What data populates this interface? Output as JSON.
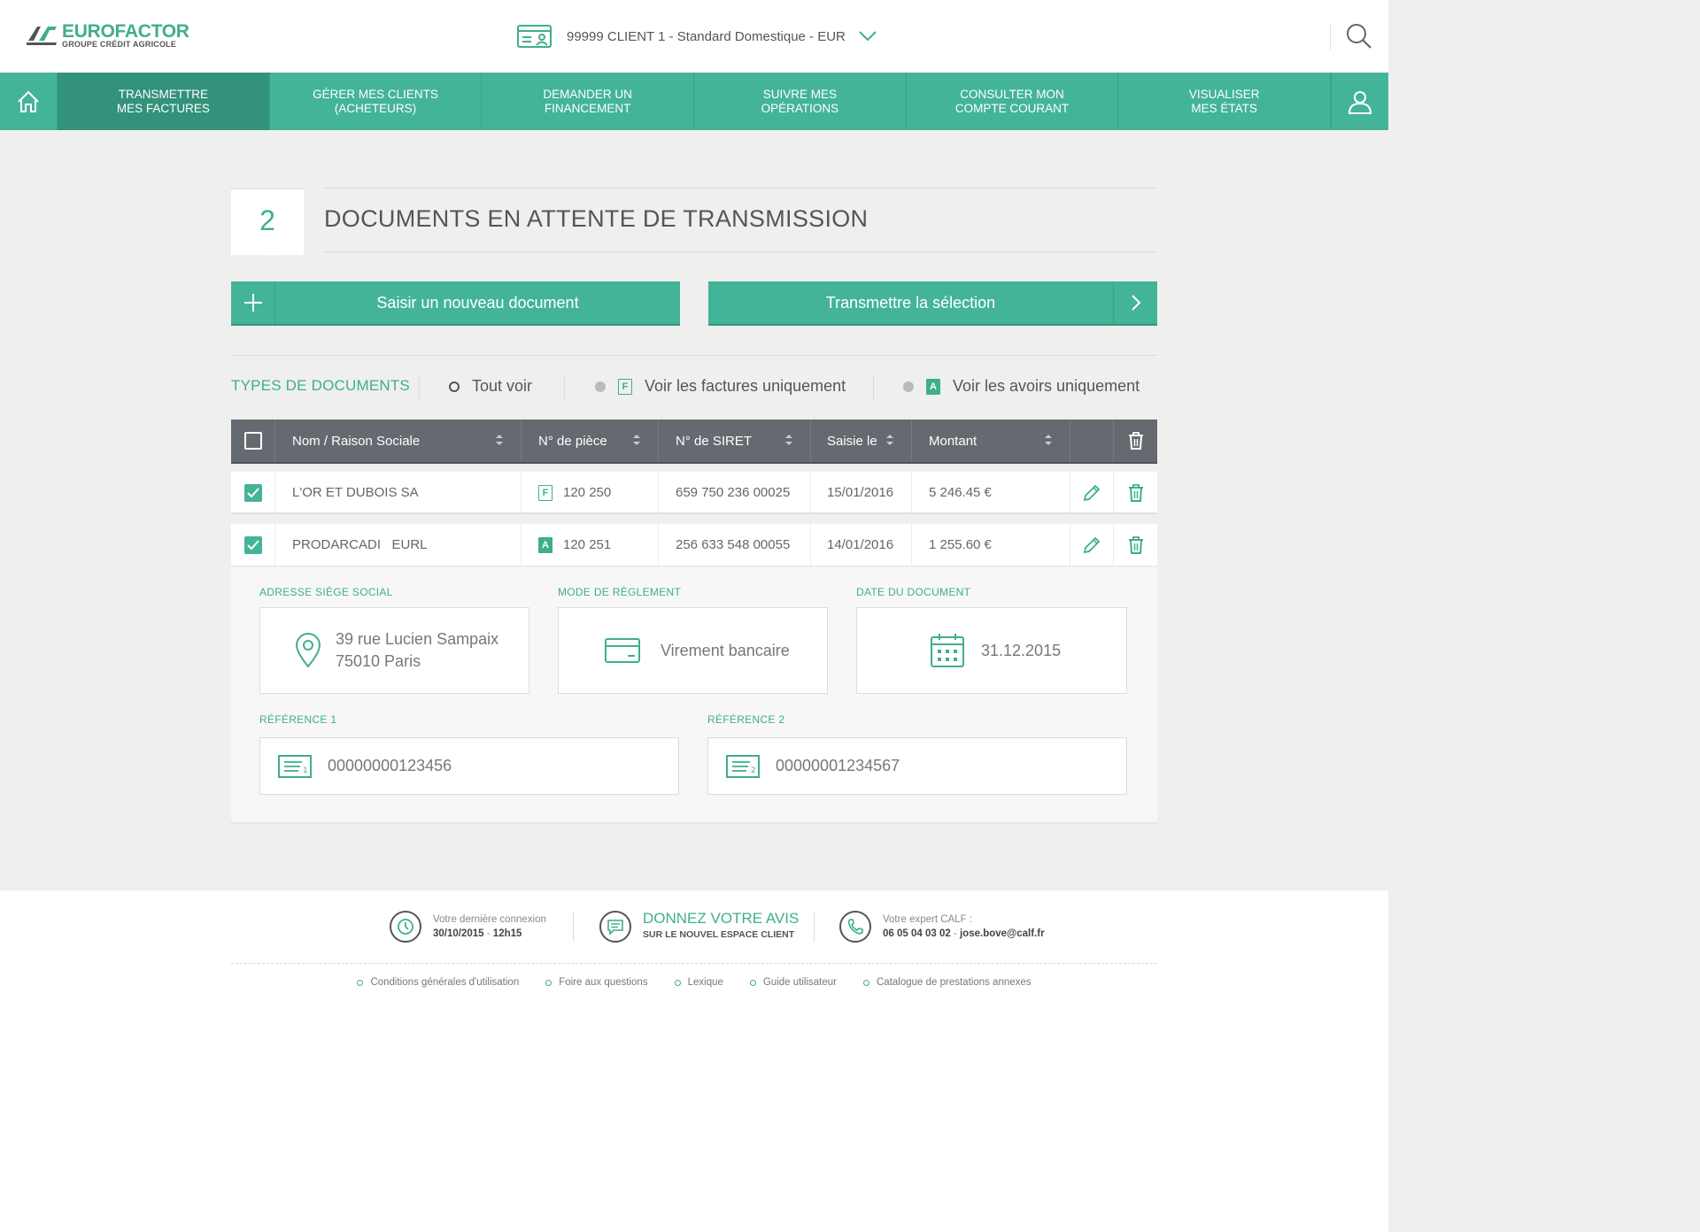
{
  "header": {
    "brand": "EUROFACTOR",
    "brand_sub": "GROUPE CRÉDIT AGRICOLE",
    "client_selector": "99999 CLIENT 1 -  Standard Domestique  - EUR"
  },
  "nav": {
    "items": [
      {
        "line1": "TRANSMETTRE",
        "line2": "MES FACTURES",
        "active": true
      },
      {
        "line1": "GÉRER MES CLIENTS",
        "line2": "(ACHETEURS)",
        "active": false
      },
      {
        "line1": "DEMANDER UN",
        "line2": "FINANCEMENT",
        "active": false
      },
      {
        "line1": "SUIVRE MES",
        "line2": "OPÉRATIONS",
        "active": false
      },
      {
        "line1": "CONSULTER MON",
        "line2": "COMPTE COURANT",
        "active": false
      },
      {
        "line1": "VISUALISER",
        "line2": "MES ÉTATS",
        "active": false
      }
    ]
  },
  "main": {
    "count": "2",
    "title": "DOCUMENTS EN ATTENTE DE TRANSMISSION",
    "new_doc_label": "Saisir un nouveau document",
    "send_label": "Transmettre la sélection",
    "filters": {
      "title": "TYPES DE DOCUMENTS",
      "all": "Tout voir",
      "invoices": "Voir les factures uniquement",
      "invoice_badge": "F",
      "credits": "Voir les avoirs uniquement",
      "credit_badge": "A"
    },
    "table": {
      "headers": [
        "Nom / Raison Sociale",
        "N° de pièce",
        "N° de SIRET",
        "Saisie le",
        "Montant"
      ],
      "rows": [
        {
          "name": "L'OR ET DUBOIS SA",
          "type": "F",
          "piece": "120 250",
          "siret": "659 750 236 00025",
          "date": "15/01/2016",
          "amount": "5 246.45 €",
          "checked": true
        },
        {
          "name": "PRODARCADI   EURL",
          "type": "A",
          "piece": "120 251",
          "siret": "256 633 548 00055",
          "date": "14/01/2016",
          "amount": "1 255.60 €",
          "checked": true
        }
      ]
    },
    "detail": {
      "address_label": "ADRESSE SIÈGE SOCIAL",
      "address_line1": "39 rue Lucien Sampaix",
      "address_line2": "75010 Paris",
      "payment_label": "MODE DE RÈGLEMENT",
      "payment_value": "Virement bancaire",
      "date_label": "DATE DU DOCUMENT",
      "date_value": "31.12.2015",
      "ref1_label": "RÉFÉRENCE 1",
      "ref1_value": "00000000123456",
      "ref2_label": "RÉFÉRENCE 2",
      "ref2_value": "00000001234567"
    }
  },
  "footer": {
    "last_login_label": "Votre dernière connexion",
    "last_login_date": "30/10/2015",
    "last_login_sep": " - ",
    "last_login_time": "12h15",
    "feedback_title": "DONNEZ VOTRE AVIS",
    "feedback_sub": "SUR LE NOUVEL ESPACE CLIENT",
    "expert_label": "Votre expert CALF :",
    "expert_phone": "06 05 04 03 02",
    "expert_sep": " - ",
    "expert_email": "jose.bove@calf.fr",
    "links": [
      "Conditions générales d'utilisation",
      "Foire aux questions",
      "Lexique",
      "Guide utilisateur",
      "Catalogue de prestations annexes"
    ]
  },
  "colors": {
    "accent": "#43b498",
    "accent_dark": "#32927a",
    "table_header": "#656a70"
  }
}
